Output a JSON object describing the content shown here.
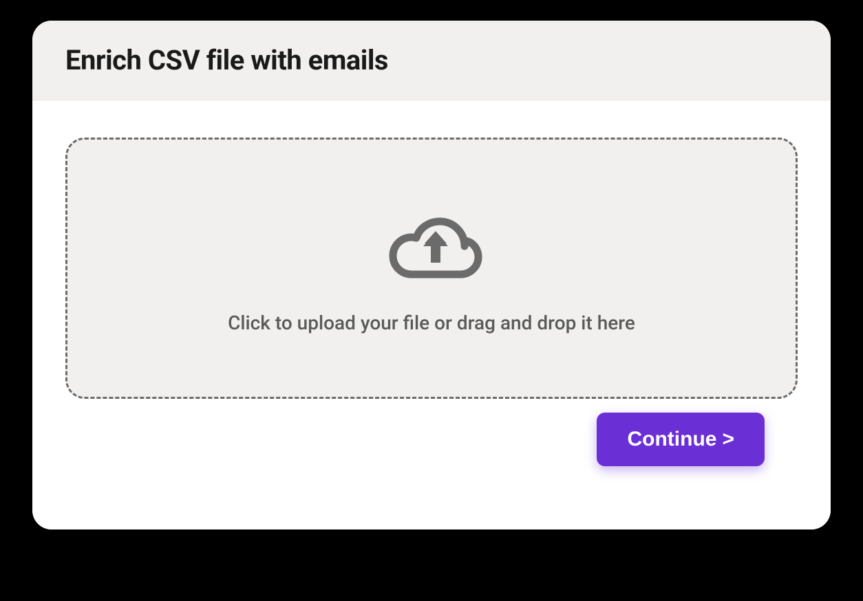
{
  "header": {
    "title": "Enrich CSV file with emails"
  },
  "dropzone": {
    "icon": "cloud-upload-icon",
    "text": "Click to upload your file or drag and drop it here"
  },
  "footer": {
    "continue_label": "Continue",
    "continue_chevron": ">"
  },
  "colors": {
    "accent": "#6b2fd6",
    "header_bg": "#f1f0ee",
    "dropzone_bg": "#f1f0ee",
    "dropzone_border": "#6b6b6b",
    "text_muted": "#5a5a5a"
  }
}
